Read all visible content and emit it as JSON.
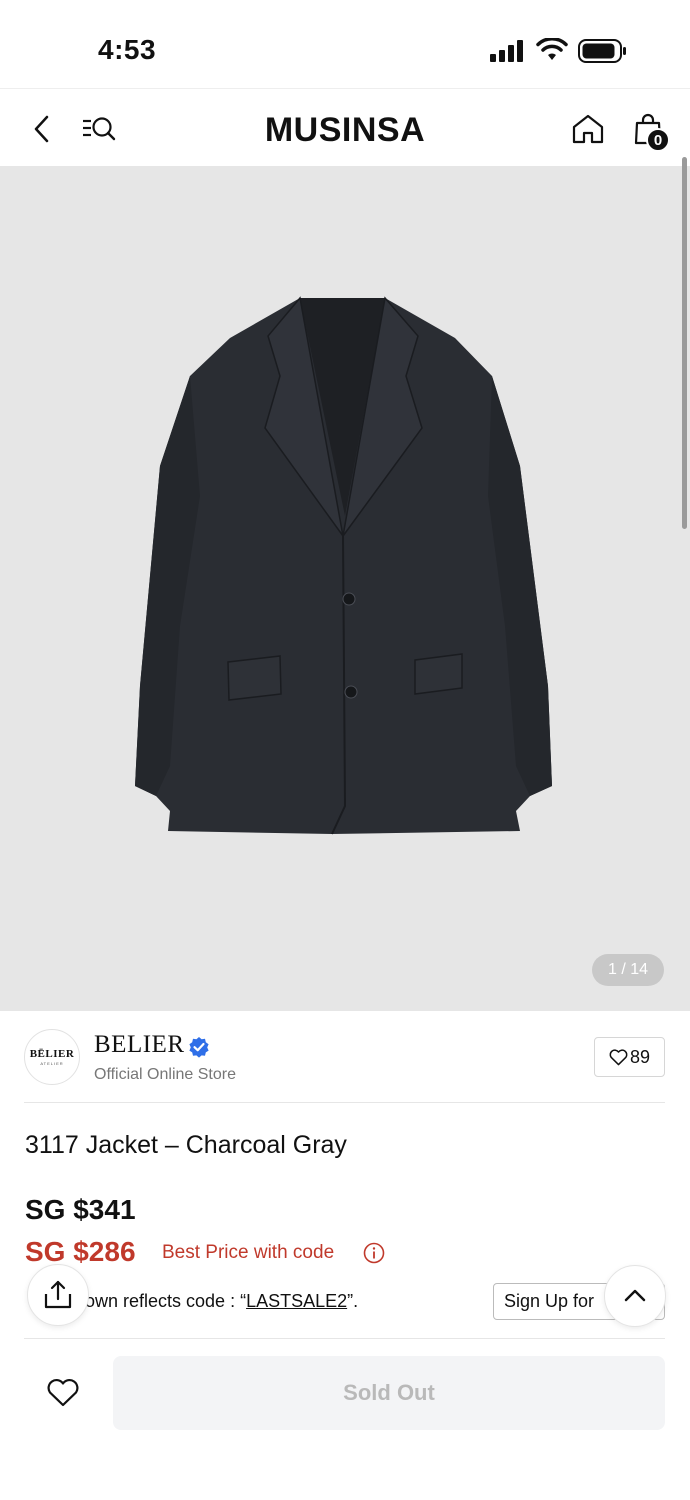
{
  "status_bar": {
    "time": "4:53"
  },
  "nav": {
    "logo": "MUSINSA",
    "cart_count": "0"
  },
  "image": {
    "counter": "1 / 14"
  },
  "brand": {
    "avatar_text": "BĒLIER",
    "avatar_subtext": "ATELIER",
    "name": "BELIER",
    "subtitle": "Official Online Store",
    "likes": "89"
  },
  "product": {
    "name": "3117 Jacket – Charcoal Gray",
    "price_original": "SG $341",
    "price_sale": "SG $286",
    "best_price_label": "Best Price with code",
    "code_note_prefix": "own reflects code : “",
    "code": "LASTSALE2",
    "code_note_suffix": "”.",
    "signup_label": "Sign Up for"
  },
  "bottom": {
    "buy_label": "Sold Out"
  },
  "colors": {
    "sale_red": "#c0392b",
    "verified_blue": "#2f6fe8",
    "image_bg": "#e6e6e6",
    "jacket": "#2a2d33"
  },
  "icons": [
    "back-icon",
    "menu-search-icon",
    "home-icon",
    "bag-icon",
    "verified-icon",
    "heart-icon",
    "info-icon",
    "share-icon",
    "chevron-up-icon"
  ]
}
